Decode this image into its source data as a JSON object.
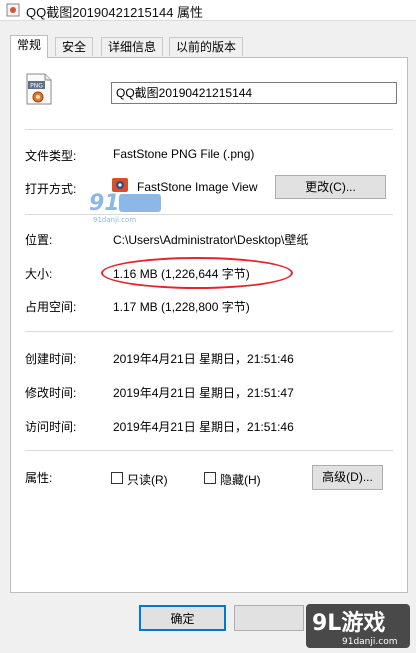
{
  "window": {
    "title": "QQ截图20190421215144 属性"
  },
  "tabs": [
    {
      "label": "常规"
    },
    {
      "label": "安全"
    },
    {
      "label": "详细信息"
    },
    {
      "label": "以前的版本"
    }
  ],
  "general": {
    "file_icon_text": "PNG",
    "filename": "QQ截图20190421215144",
    "file_type_label": "文件类型:",
    "file_type_value": "FastStone PNG File (.png)",
    "open_with_label": "打开方式:",
    "open_with_value": "FastStone Image View",
    "change_button": "更改(C)...",
    "location_label": "位置:",
    "location_value": "C:\\Users\\Administrator\\Desktop\\壁纸",
    "size_label": "大小:",
    "size_value": "1.16 MB (1,226,644 字节)",
    "disk_size_label": "占用空间:",
    "disk_size_value": "1.17 MB (1,228,800 字节)",
    "created_label": "创建时间:",
    "created_value": "2019年4月21日 星期日，21:51:46",
    "modified_label": "修改时间:",
    "modified_value": "2019年4月21日 星期日，21:51:47",
    "accessed_label": "访问时间:",
    "accessed_value": "2019年4月21日 星期日，21:51:46",
    "attributes_label": "属性:",
    "readonly_label": "只读(R)",
    "hidden_label": "隐藏(H)",
    "advanced_button": "高级(D)..."
  },
  "footer": {
    "ok_button": "确定"
  },
  "watermarks": {
    "small_text": "91danji.com",
    "big_logo": "9L游戏",
    "big_url": "91danji.com"
  },
  "colors": {
    "highlight_oval": "#e0262c",
    "watermark_blue": "#2f7fd6"
  }
}
